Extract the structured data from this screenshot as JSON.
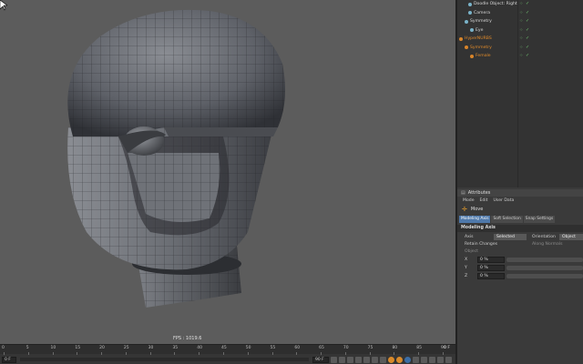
{
  "viewport": {
    "fps_label": "FPS : 1019.6"
  },
  "timeline": {
    "ticks": [
      "0",
      "5",
      "10",
      "15",
      "20",
      "25",
      "30",
      "35",
      "40",
      "45",
      "50",
      "55",
      "60",
      "65",
      "70",
      "75",
      "80",
      "85",
      "90"
    ],
    "end_label": "0 F",
    "current_frame": "0 F",
    "end_frame": "90 F"
  },
  "objects": {
    "items": [
      {
        "name": "Doodle Object: Right",
        "color": "normal"
      },
      {
        "name": "Camera",
        "color": "normal"
      },
      {
        "name": "Symmetry",
        "color": "normal"
      },
      {
        "name": "Eye",
        "color": "normal"
      },
      {
        "name": "HyperNURBS",
        "color": "orange"
      },
      {
        "name": "Symmetry",
        "color": "orange"
      },
      {
        "name": "Female",
        "color": "orange"
      }
    ]
  },
  "attributes": {
    "title": "Attributes",
    "menu": [
      "Mode",
      "Edit",
      "User Data"
    ],
    "tool_name": "Move",
    "tabs": [
      "Modeling Axis",
      "Soft Selection",
      "Snap Settings"
    ],
    "section": "Modeling Axis",
    "axis_label": "Axis",
    "axis_value": "Selected",
    "orientation_label": "Orientation",
    "orientation_value": "Object",
    "retain_label": "Retain Changes",
    "along_normals_label": "Along Normals",
    "object_label": "Object",
    "x_label": "X",
    "y_label": "Y",
    "z_label": "Z",
    "x_value": "0 %",
    "y_value": "0 %",
    "z_value": "0 %"
  }
}
